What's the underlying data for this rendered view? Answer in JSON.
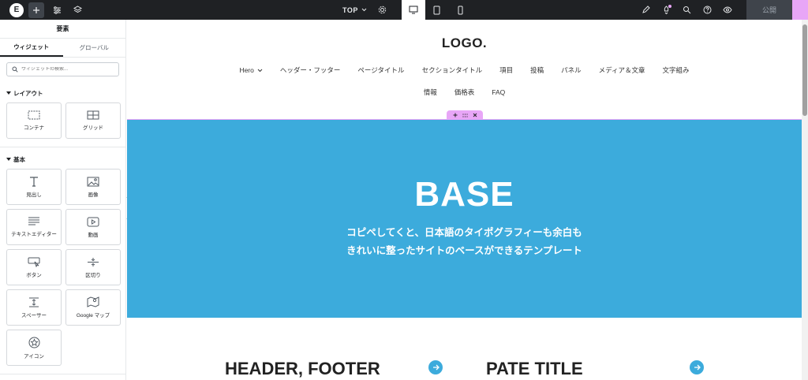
{
  "topbar": {
    "logo_letter": "E",
    "page_name": "TOP",
    "publish_label": "公開"
  },
  "panel": {
    "title": "要素",
    "tabs": [
      "ウィジェット",
      "グローバル"
    ],
    "search_placeholder": "ウィジェットの検索...",
    "layout_heading": "レイアウト",
    "layout_widgets": [
      {
        "label": "コンテナ",
        "icon": "container-icon"
      },
      {
        "label": "グリッド",
        "icon": "grid-icon"
      }
    ],
    "basic_heading": "基本",
    "basic_widgets": [
      {
        "label": "見出し",
        "icon": "heading-icon"
      },
      {
        "label": "画像",
        "icon": "image-icon"
      },
      {
        "label": "テキストエディター",
        "icon": "text-editor-icon"
      },
      {
        "label": "動画",
        "icon": "video-icon"
      },
      {
        "label": "ボタン",
        "icon": "button-icon"
      },
      {
        "label": "区切り",
        "icon": "divider-icon"
      },
      {
        "label": "スペーサー",
        "icon": "spacer-icon"
      },
      {
        "label": "Google マップ",
        "icon": "map-icon"
      },
      {
        "label": "アイコン",
        "icon": "star-icon"
      }
    ]
  },
  "site": {
    "logo": "LOGO.",
    "nav_row1": [
      "Hero",
      "ヘッダー・フッター",
      "ページタイトル",
      "セクションタイトル",
      "項目",
      "投稿",
      "パネル",
      "メディア＆文章",
      "文字組み"
    ],
    "nav_row2": [
      "情報",
      "価格表",
      "FAQ"
    ],
    "hero_title": "BASE",
    "hero_sub_line1": "コピペしてくと、日本語のタイポグラフィーも余白も",
    "hero_sub_line2": "きれいに整ったサイトのベースができるテンプレート",
    "card1_title": "HEADER, FOOTER",
    "card2_title": "PATE TITLE"
  },
  "colors": {
    "hero_bg": "#3cabdc",
    "accent_pink": "#e8a6f7",
    "topbar_bg": "#1f2124"
  }
}
